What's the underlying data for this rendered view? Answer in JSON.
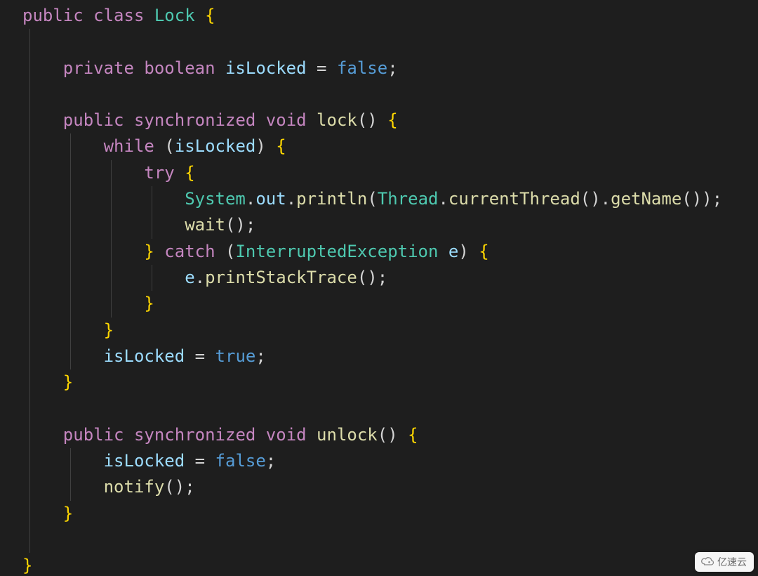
{
  "code": {
    "lines": [
      {
        "indent": 0,
        "guides": 0,
        "tokens": [
          {
            "t": "public ",
            "c": "kw"
          },
          {
            "t": "class ",
            "c": "kw"
          },
          {
            "t": "Lock",
            "c": "type"
          },
          {
            "t": " ",
            "c": "punc"
          },
          {
            "t": "{",
            "c": "brace"
          }
        ]
      },
      {
        "indent": 0,
        "guides": 1,
        "tokens": []
      },
      {
        "indent": 1,
        "guides": 1,
        "tokens": [
          {
            "t": "private ",
            "c": "kw"
          },
          {
            "t": "boolean ",
            "c": "kw"
          },
          {
            "t": "isLocked",
            "c": "var"
          },
          {
            "t": " = ",
            "c": "punc"
          },
          {
            "t": "false",
            "c": "lit"
          },
          {
            "t": ";",
            "c": "punc"
          }
        ]
      },
      {
        "indent": 0,
        "guides": 1,
        "tokens": []
      },
      {
        "indent": 1,
        "guides": 1,
        "tokens": [
          {
            "t": "public ",
            "c": "kw"
          },
          {
            "t": "synchronized ",
            "c": "kw"
          },
          {
            "t": "void ",
            "c": "kw"
          },
          {
            "t": "lock",
            "c": "func"
          },
          {
            "t": "() ",
            "c": "punc"
          },
          {
            "t": "{",
            "c": "brace"
          }
        ]
      },
      {
        "indent": 2,
        "guides": 2,
        "tokens": [
          {
            "t": "while",
            "c": "kw"
          },
          {
            "t": " (",
            "c": "punc"
          },
          {
            "t": "isLocked",
            "c": "var"
          },
          {
            "t": ") ",
            "c": "punc"
          },
          {
            "t": "{",
            "c": "brace"
          }
        ]
      },
      {
        "indent": 3,
        "guides": 3,
        "tokens": [
          {
            "t": "try",
            "c": "kw"
          },
          {
            "t": " ",
            "c": "punc"
          },
          {
            "t": "{",
            "c": "brace"
          }
        ]
      },
      {
        "indent": 4,
        "guides": 4,
        "tokens": [
          {
            "t": "System",
            "c": "type"
          },
          {
            "t": ".",
            "c": "punc"
          },
          {
            "t": "out",
            "c": "var"
          },
          {
            "t": ".",
            "c": "punc"
          },
          {
            "t": "println",
            "c": "func"
          },
          {
            "t": "(",
            "c": "punc"
          },
          {
            "t": "Thread",
            "c": "type"
          },
          {
            "t": ".",
            "c": "punc"
          },
          {
            "t": "currentThread",
            "c": "func"
          },
          {
            "t": "().",
            "c": "punc"
          },
          {
            "t": "getName",
            "c": "func"
          },
          {
            "t": "());",
            "c": "punc"
          }
        ]
      },
      {
        "indent": 4,
        "guides": 4,
        "tokens": [
          {
            "t": "wait",
            "c": "func"
          },
          {
            "t": "();",
            "c": "punc"
          }
        ]
      },
      {
        "indent": 3,
        "guides": 3,
        "tokens": [
          {
            "t": "}",
            "c": "brace"
          },
          {
            "t": " ",
            "c": "punc"
          },
          {
            "t": "catch",
            "c": "kw"
          },
          {
            "t": " (",
            "c": "punc"
          },
          {
            "t": "InterruptedException",
            "c": "type"
          },
          {
            "t": " ",
            "c": "punc"
          },
          {
            "t": "e",
            "c": "var"
          },
          {
            "t": ") ",
            "c": "punc"
          },
          {
            "t": "{",
            "c": "brace"
          }
        ]
      },
      {
        "indent": 4,
        "guides": 4,
        "tokens": [
          {
            "t": "e",
            "c": "var"
          },
          {
            "t": ".",
            "c": "punc"
          },
          {
            "t": "printStackTrace",
            "c": "func"
          },
          {
            "t": "();",
            "c": "punc"
          }
        ]
      },
      {
        "indent": 3,
        "guides": 3,
        "tokens": [
          {
            "t": "}",
            "c": "brace"
          }
        ]
      },
      {
        "indent": 2,
        "guides": 2,
        "tokens": [
          {
            "t": "}",
            "c": "brace"
          }
        ]
      },
      {
        "indent": 2,
        "guides": 2,
        "tokens": [
          {
            "t": "isLocked",
            "c": "var"
          },
          {
            "t": " = ",
            "c": "punc"
          },
          {
            "t": "true",
            "c": "lit"
          },
          {
            "t": ";",
            "c": "punc"
          }
        ]
      },
      {
        "indent": 1,
        "guides": 1,
        "tokens": [
          {
            "t": "}",
            "c": "brace"
          }
        ]
      },
      {
        "indent": 0,
        "guides": 1,
        "tokens": []
      },
      {
        "indent": 1,
        "guides": 1,
        "tokens": [
          {
            "t": "public ",
            "c": "kw"
          },
          {
            "t": "synchronized ",
            "c": "kw"
          },
          {
            "t": "void ",
            "c": "kw"
          },
          {
            "t": "unlock",
            "c": "func"
          },
          {
            "t": "() ",
            "c": "punc"
          },
          {
            "t": "{",
            "c": "brace"
          }
        ]
      },
      {
        "indent": 2,
        "guides": 2,
        "tokens": [
          {
            "t": "isLocked",
            "c": "var"
          },
          {
            "t": " = ",
            "c": "punc"
          },
          {
            "t": "false",
            "c": "lit"
          },
          {
            "t": ";",
            "c": "punc"
          }
        ]
      },
      {
        "indent": 2,
        "guides": 2,
        "tokens": [
          {
            "t": "notify",
            "c": "func"
          },
          {
            "t": "();",
            "c": "punc"
          }
        ]
      },
      {
        "indent": 1,
        "guides": 1,
        "tokens": [
          {
            "t": "}",
            "c": "brace"
          }
        ]
      },
      {
        "indent": 0,
        "guides": 1,
        "tokens": []
      },
      {
        "indent": 0,
        "guides": 0,
        "tokens": [
          {
            "t": "}",
            "c": "brace"
          }
        ]
      }
    ],
    "indent_unit": "    "
  },
  "watermark": {
    "text": "亿速云"
  }
}
